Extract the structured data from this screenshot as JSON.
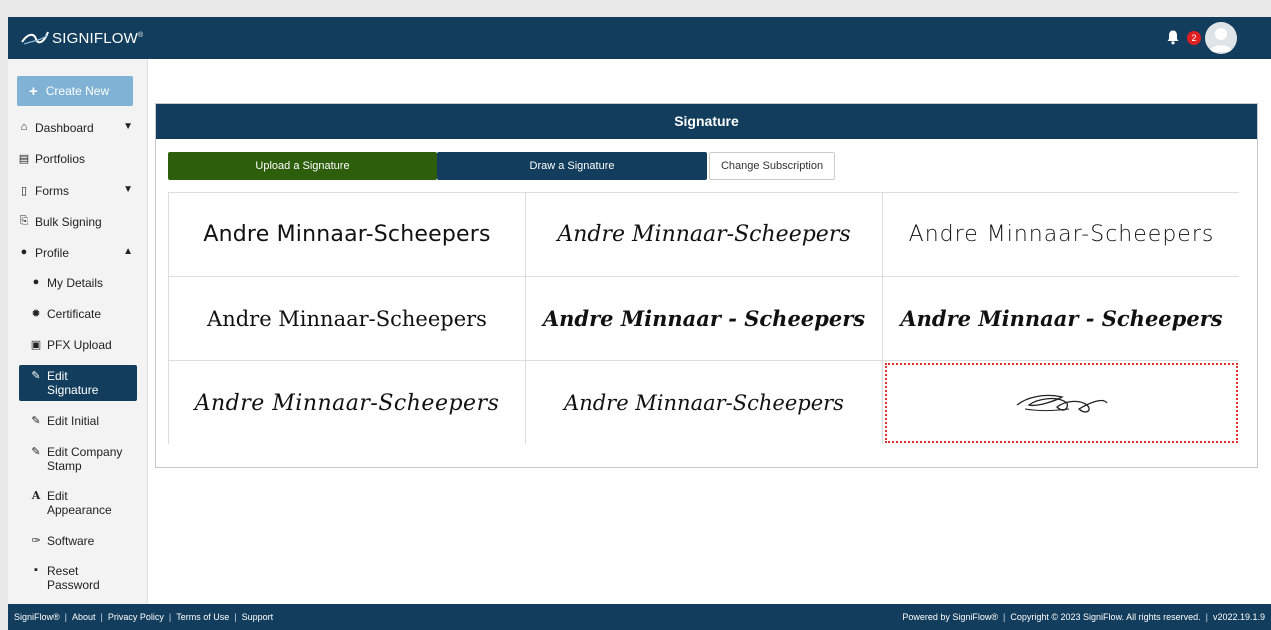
{
  "brand": {
    "name": "SIGNIFLOW",
    "mark": "®"
  },
  "notifications": {
    "count": "2"
  },
  "sidebar": {
    "create_label": "Create New",
    "items": [
      {
        "label": "Dashboard"
      },
      {
        "label": "Portfolios"
      },
      {
        "label": "Forms"
      },
      {
        "label": "Bulk Signing"
      },
      {
        "label": "Profile"
      }
    ],
    "sub_items": [
      {
        "label": "My Details"
      },
      {
        "label": "Certificate"
      },
      {
        "label": "PFX Upload"
      },
      {
        "label_line1": "Edit",
        "label_line2": "Signature"
      },
      {
        "label": "Edit Initial"
      },
      {
        "label_line1": "Edit Company",
        "label_line2": "Stamp"
      },
      {
        "label_line1": "Edit",
        "label_line2": "Appearance"
      },
      {
        "label": "Software"
      },
      {
        "label_line1": "Reset",
        "label_line2": "Password"
      }
    ]
  },
  "panel": {
    "title": "Signature",
    "tabs": {
      "upload": "Upload a Signature",
      "draw": "Draw a Signature",
      "subscription": "Change Subscription"
    },
    "signature_options": [
      "Andre Minnaar-Scheepers",
      "Andre Minnaar-Scheepers",
      "Andre Minnaar-Scheepers",
      "Andre Minnaar-Scheepers",
      "Andre Minnaar - Scheepers",
      "Andre Minnaar - Scheepers",
      "Andre Minnaar-Scheepers",
      "Andre Minnaar-Scheepers"
    ]
  },
  "footer": {
    "links": [
      "SigniFlow®",
      "About",
      "Privacy Policy",
      "Terms of Use",
      "Support"
    ],
    "powered": "Powered by SigniFlow®",
    "copyright": "Copyright © 2023 SigniFlow. All rights reserved.",
    "version": "v2022.19.1.9"
  },
  "colors": {
    "brand_navy": "#123d5c",
    "upload_green": "#2d5e0c",
    "create_blue": "#7fb2d4",
    "badge_red": "#e02020",
    "selected_outline": "#e03030"
  }
}
